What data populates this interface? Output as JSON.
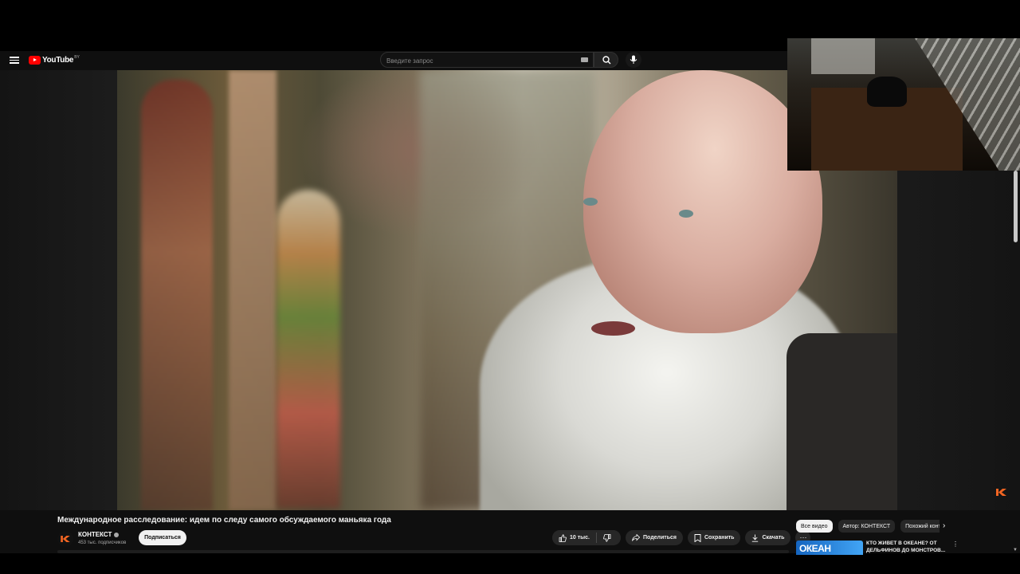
{
  "masthead": {
    "logo_text": "YouTube",
    "country_code": "BY",
    "search_placeholder": "Введите запрос"
  },
  "video": {
    "title": "Международное расследование: идем по следу самого обсуждаемого маньяка года",
    "channel_name": "КОНТЕКСТ",
    "subscribers": "453 тыс. подписчиков",
    "subscribe_label": "Подписаться",
    "likes": "10 тыс.",
    "share_label": "Поделиться",
    "save_label": "Сохранить",
    "download_label": "Скачать"
  },
  "sidebar": {
    "chips": [
      "Все видео",
      "Автор: КОНТЕКСТ",
      "Похожий контент"
    ],
    "related": [
      {
        "thumb_text": "ОКЕАН",
        "title": "КТО ЖИВЕТ В ОКЕАНЕ? ОТ ДЕЛЬФИНОВ ДО МОНСТРОВ..."
      }
    ]
  },
  "colors": {
    "background": "#0f0f0f",
    "accent_red": "#ff0000",
    "pill": "#272727",
    "brand_orange": "#f26522"
  },
  "icons": {
    "menu": "hamburger-icon",
    "search": "search-icon",
    "mic": "mic-icon",
    "like": "thumbs-up-icon",
    "dislike": "thumbs-down-icon",
    "share": "share-icon",
    "save": "playlist-add-icon",
    "download": "download-icon",
    "more": "more-horiz-icon"
  }
}
